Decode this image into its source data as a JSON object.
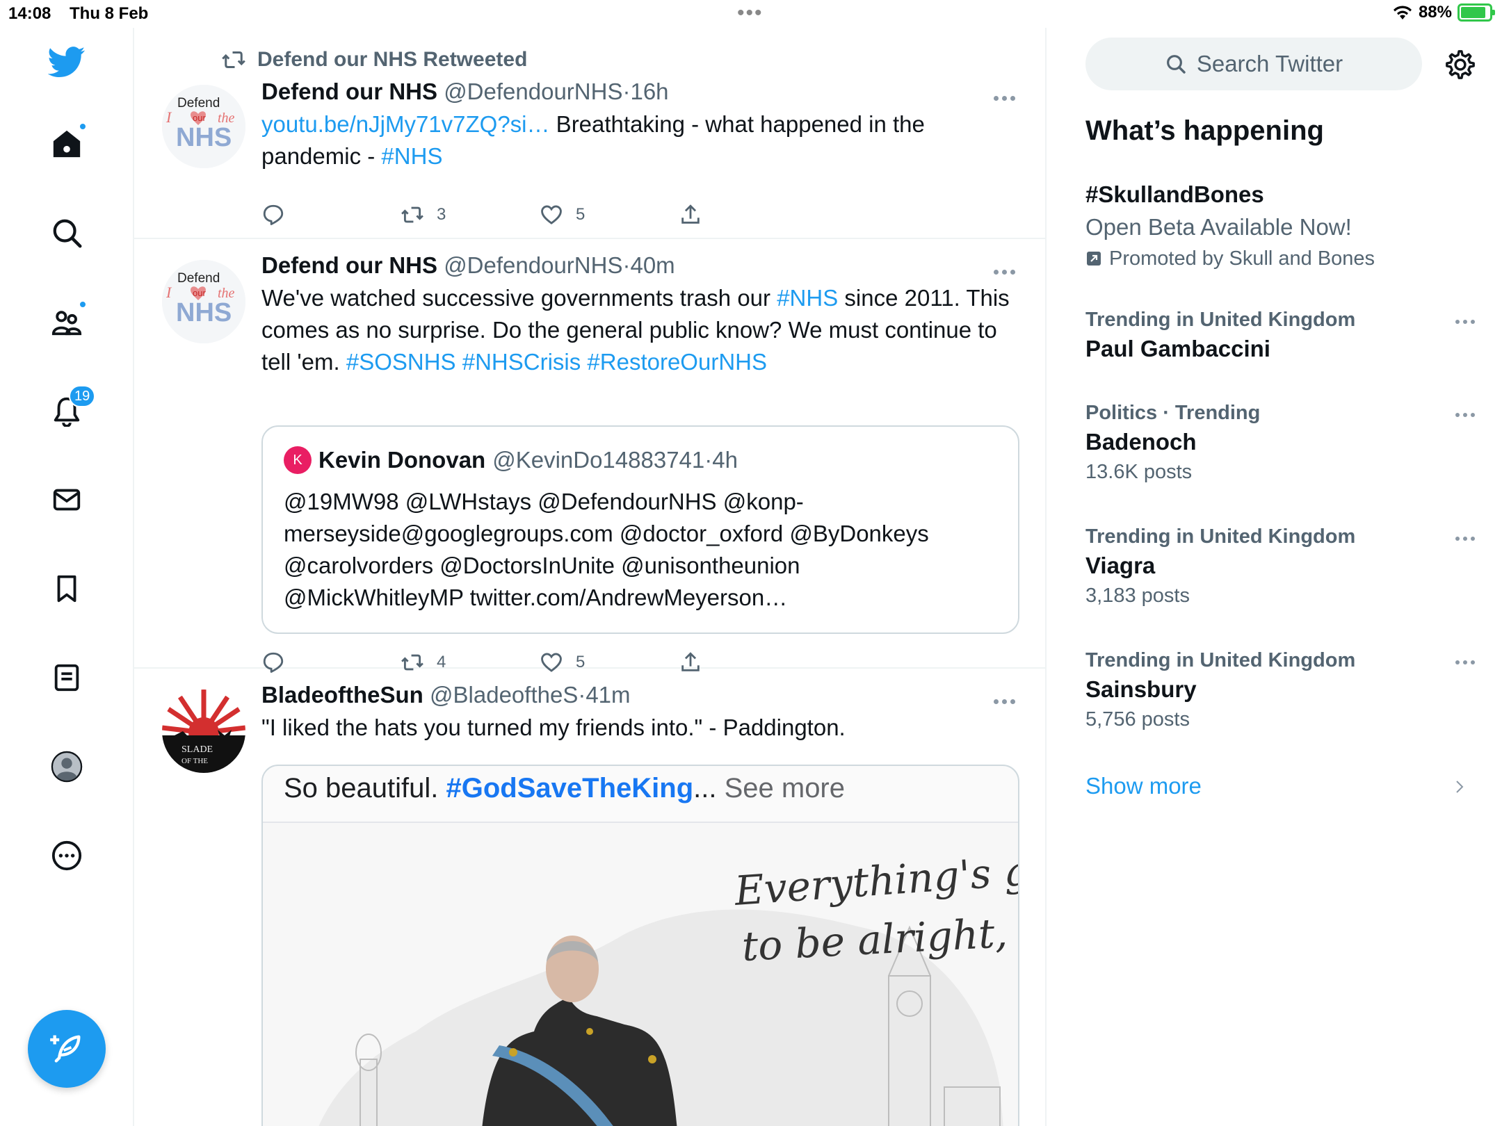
{
  "status_bar": {
    "time": "14:08",
    "date": "Thu 8 Feb",
    "battery": "88%",
    "battery_level": 0.88
  },
  "nav": {
    "notifications_count": "19"
  },
  "timeline": {
    "tweets": [
      {
        "retweeted_by": "Defend our NHS Retweeted",
        "name": "Defend our NHS",
        "handle": "@DefendourNHS",
        "sep": "·",
        "time": "16h",
        "link": "youtu.be/nJjMy71v7ZQ?si…",
        "text": " Breathtaking - what happened in the pandemic - ",
        "tag": "#NHS",
        "retweets": "3",
        "likes": "5"
      },
      {
        "name": "Defend our NHS",
        "handle": "@DefendourNHS",
        "sep": "·",
        "time": "40m",
        "text_a": "We've watched successive governments trash our ",
        "tag_a": "#NHS",
        "text_b": " since 2011. This comes as no surprise. Do the general public know? We must continue to tell 'em. ",
        "tags_b": "#SOSNHS #NHSCrisis #RestoreOurNHS",
        "retweets": "4",
        "likes": "5",
        "quote": {
          "avatar_letter": "K",
          "name": "Kevin Donovan",
          "handle": "@KevinDo14883741",
          "sep": "·",
          "time": "4h",
          "text": "@19MW98 @LWHstays @DefendourNHS @konp-merseyside@googlegroups.com @doctor_oxford @ByDonkeys @carolvorders @DoctorsInUnite @unisontheunion @MickWhitleyMP twitter.com/AndrewMeyerson…"
        }
      },
      {
        "name": "BladeoftheSun",
        "handle": "@BladeoftheS",
        "sep": "·",
        "time": "41m",
        "text": "\"I liked the hats you turned my friends into.\" - Paddington.",
        "media": {
          "caption_prefix": "So beautiful. ",
          "caption_tag": "#GodSaveTheKing",
          "caption_ellipsis": "...",
          "caption_see_more": " See more",
          "script_line1": "Everything's going",
          "script_line2": "to be alright, Sir"
        }
      }
    ]
  },
  "avatars": {
    "nhs_line1": "Defend",
    "nhs_line2": "our",
    "nhs_line3": "NHS",
    "blade_text1": "SLADE",
    "blade_text2": "OF THE"
  },
  "sidebar": {
    "search_placeholder": "Search Twitter",
    "heading": "What’s happening",
    "promo": {
      "title": "#SkullandBones",
      "subtitle": "Open Beta Available Now!",
      "by": "Promoted by Skull and Bones"
    },
    "trends": [
      {
        "context": "Trending in United Kingdom",
        "title": "Paul Gambaccini",
        "count": ""
      },
      {
        "context": "Politics · Trending",
        "title": "Badenoch",
        "count": "13.6K posts"
      },
      {
        "context": "Trending in United Kingdom",
        "title": "Viagra",
        "count": "3,183 posts"
      },
      {
        "context": "Trending in United Kingdom",
        "title": "Sainsbury",
        "count": "5,756 posts"
      }
    ],
    "show_more": "Show more"
  },
  "colors": {
    "accent": "#1d9bf0",
    "text": "#0f1419",
    "secondary": "#536471",
    "border": "#eff3f4"
  }
}
